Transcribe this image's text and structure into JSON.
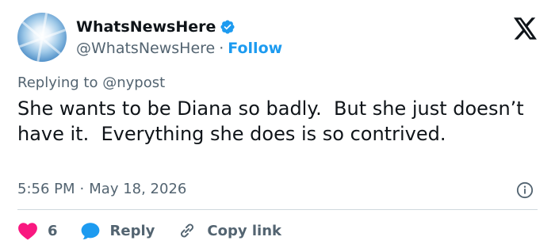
{
  "author": {
    "display_name": "WhatsNewsHere",
    "handle": "@WhatsNewsHere",
    "separator": "·",
    "follow_label": "Follow",
    "verified_color": "#1d9bf0"
  },
  "tweet": {
    "replying_prefix": "Replying to",
    "replying_to": "@nypost",
    "text": "She wants to be Diana so badly.  But she just doesn’t have it.  Everything she does is so contrived.",
    "time": "5:56 PM",
    "meta_separator": "·",
    "date": "May 18, 2026"
  },
  "actions": {
    "like_count": "6",
    "like_color": "#f91880",
    "reply_label": "Reply",
    "reply_color": "#1d9bf0",
    "copy_link_label": "Copy link"
  },
  "icons": {
    "verified": "verified-badge-icon",
    "x_logo": "x-logo-icon",
    "info": "info-icon",
    "like": "heart-icon",
    "reply": "reply-bubble-icon",
    "copy_link": "link-icon"
  }
}
